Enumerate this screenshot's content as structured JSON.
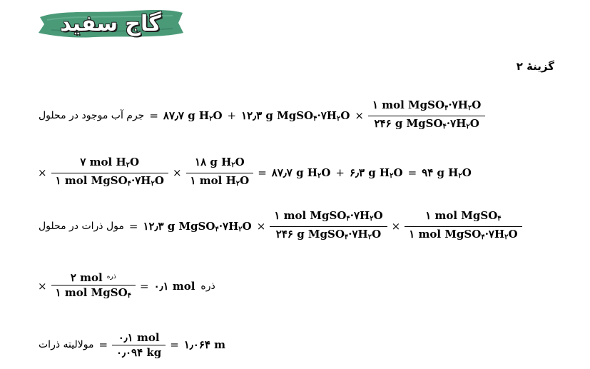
{
  "logo": {
    "text": "گاج سفید",
    "bg_color": "#4a9a78"
  },
  "option_label": "گزینهٔ ۲",
  "eq1": {
    "label": "جرم آب موجود در محلول",
    "eq": "=",
    "t1": "۸۷٫۷ g H",
    "t1_sub": "۲",
    "t1_end": "O",
    "plus": "+",
    "t2": "۱۲٫۳ g MgSO",
    "t2_sub": "۴",
    "t2_mid": "·۷H",
    "t2_sub2": "۲",
    "t2_end": "O",
    "times": "×",
    "frac": {
      "num": "۱ mol MgSO",
      "num_sub": "۴",
      "num_mid": "·۷H",
      "num_sub2": "۲",
      "num_end": "O",
      "den": "۲۴۶ g MgSO",
      "den_sub": "۴",
      "den_mid": "·۷H",
      "den_sub2": "۲",
      "den_end": "O"
    }
  },
  "eq2": {
    "times1": "×",
    "frac1": {
      "num": "۷ mol H",
      "num_sub": "۲",
      "num_end": "O",
      "den": "۱ mol MgSO",
      "den_sub": "۴",
      "den_mid": "·۷H",
      "den_sub2": "۲",
      "den_end": "O"
    },
    "times2": "×",
    "frac2": {
      "num": "۱۸ g H",
      "num_sub": "۲",
      "num_end": "O",
      "den": "۱ mol H",
      "den_sub": "۲",
      "den_end": "O"
    },
    "eq": "=",
    "t1": "۸۷٫۷ g H",
    "t1_sub": "۲",
    "t1_end": "O",
    "plus": "+",
    "t2": "۶٫۳ g H",
    "t2_sub": "۲",
    "t2_end": "O",
    "eq2": "=",
    "t3": "۹۴ g H",
    "t3_sub": "۲",
    "t3_end": "O"
  },
  "eq3": {
    "label": "مول ذرات در محلول",
    "eq": "=",
    "t1": "۱۲٫۳ g MgSO",
    "t1_sub": "۴",
    "t1_mid": "·۷H",
    "t1_sub2": "۲",
    "t1_end": "O",
    "times1": "×",
    "frac1": {
      "num": "۱ mol MgSO",
      "num_sub": "۴",
      "num_mid": "·۷H",
      "num_sub2": "۲",
      "num_end": "O",
      "den": "۲۴۶ g MgSO",
      "den_sub": "۴",
      "den_mid": "·۷H",
      "den_sub2": "۲",
      "den_end": "O"
    },
    "times2": "×",
    "frac2": {
      "num": "۱ mol MgSO",
      "num_sub": "۴",
      "den": "۱ mol MgSO",
      "den_sub": "۴",
      "den_mid": "·۷H",
      "den_sub2": "۲",
      "den_end": "O"
    }
  },
  "eq4": {
    "times": "×",
    "frac": {
      "num": "۲ mol",
      "num_word": "ذره",
      "den": "۱ mol MgSO",
      "den_sub": "۴"
    },
    "eq": "=",
    "result": "۰٫۱ mol",
    "result_word": "ذره"
  },
  "eq5": {
    "label": "مولالیته ذرات",
    "eq": "=",
    "frac": {
      "num": "۰٫۱ mol",
      "den": "۰٫۰۹۴ kg"
    },
    "eq2": "=",
    "result": "۱٫۰۶۴ m"
  }
}
